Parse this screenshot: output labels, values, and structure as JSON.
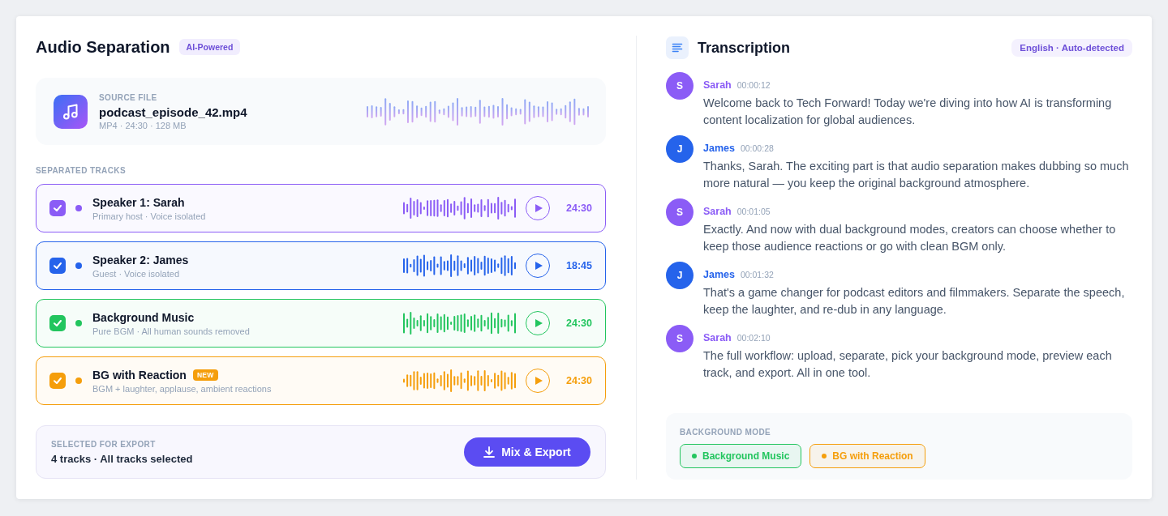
{
  "header": {
    "title": "Audio Separation",
    "badge": "AI-Powered"
  },
  "source": {
    "label": "SOURCE FILE",
    "filename": "podcast_episode_42.mp4",
    "meta": "MP4 · 24:30 · 128 MB"
  },
  "tracks_section": {
    "label": "SEPARATED TRACKS"
  },
  "tracks": [
    {
      "name": "Speaker 1: Sarah",
      "subtitle": "Primary host · Voice isolated",
      "duration": "24:30",
      "checked": true,
      "color": "#8b5cf6"
    },
    {
      "name": "Speaker 2: James",
      "subtitle": "Guest · Voice isolated",
      "duration": "18:45",
      "checked": true,
      "color": "#2563eb"
    },
    {
      "name": "Background Music",
      "subtitle": "Pure BGM · All human sounds removed",
      "duration": "24:30",
      "checked": true,
      "color": "#22c55e"
    },
    {
      "name": "BG with Reaction",
      "badge": "NEW",
      "subtitle": "BGM + laughter, applause, ambient reactions",
      "duration": "24:30",
      "checked": true,
      "color": "#f59e0b"
    }
  ],
  "export": {
    "label": "SELECTED FOR EXPORT",
    "summary": "4 tracks · All tracks selected",
    "button": "Mix & Export"
  },
  "transcription": {
    "title": "Transcription",
    "language": "English · Auto-detected",
    "messages": [
      {
        "initial": "S",
        "speaker": "Sarah",
        "time": "00:00:12",
        "text": "Welcome back to Tech Forward! Today we're diving into how AI is transforming content localization for global audiences.",
        "color": "#8b5cf6"
      },
      {
        "initial": "J",
        "speaker": "James",
        "time": "00:00:28",
        "text": "Thanks, Sarah. The exciting part is that audio separation makes dubbing so much more natural — you keep the original background atmosphere.",
        "color": "#2563eb"
      },
      {
        "initial": "S",
        "speaker": "Sarah",
        "time": "00:01:05",
        "text": "Exactly. And now with dual background modes, creators can choose whether to keep those audience reactions or go with clean BGM only.",
        "color": "#8b5cf6"
      },
      {
        "initial": "J",
        "speaker": "James",
        "time": "00:01:32",
        "text": "That's a game changer for podcast editors and filmmakers. Separate the speech, keep the laughter, and re-dub in any language.",
        "color": "#2563eb"
      },
      {
        "initial": "S",
        "speaker": "Sarah",
        "time": "00:02:10",
        "text": "The full workflow: upload, separate, pick your background mode, preview each track, and export. All in one tool.",
        "color": "#8b5cf6"
      }
    ]
  },
  "background_mode": {
    "label": "BACKGROUND MODE",
    "options": [
      {
        "label": "Background Music",
        "color": "#22c55e"
      },
      {
        "label": "BG with Reaction",
        "color": "#f59e0b"
      }
    ]
  }
}
